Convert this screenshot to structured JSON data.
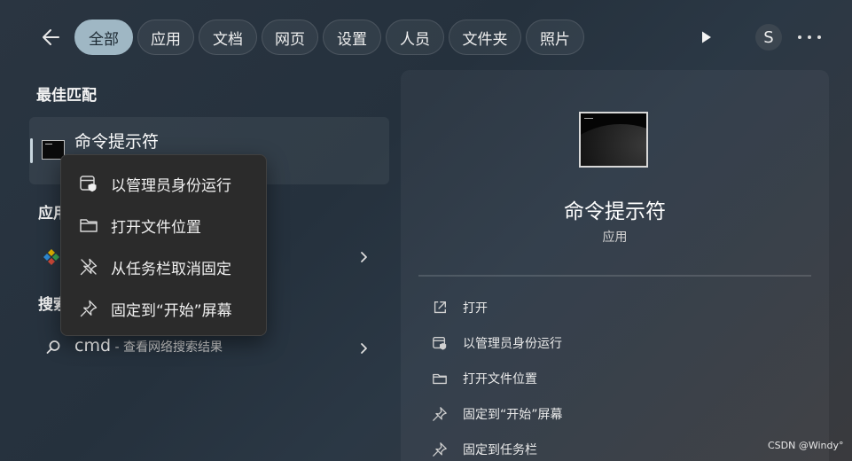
{
  "filters": {
    "items": [
      "全部",
      "应用",
      "文档",
      "网页",
      "设置",
      "人员",
      "文件夹",
      "照片"
    ],
    "active_index": 0
  },
  "avatar_initial": "S",
  "best_match": {
    "heading": "最佳匹配",
    "title": "命令提示符"
  },
  "apps_heading": "应用",
  "search_heading": "搜索",
  "web_search": {
    "query": "cmd",
    "suffix": " - 查看网络搜索结果"
  },
  "context_menu": {
    "items": [
      {
        "label": "以管理员身份运行",
        "icon": "admin-shield-icon"
      },
      {
        "label": "打开文件位置",
        "icon": "folder-icon"
      },
      {
        "label": "从任务栏取消固定",
        "icon": "unpin-icon"
      },
      {
        "label": "固定到“开始”屏幕",
        "icon": "pin-icon"
      }
    ]
  },
  "details": {
    "title": "命令提示符",
    "subtitle": "应用",
    "actions": [
      {
        "label": "打开",
        "icon": "open-external-icon"
      },
      {
        "label": "以管理员身份运行",
        "icon": "admin-shield-icon"
      },
      {
        "label": "打开文件位置",
        "icon": "folder-icon"
      },
      {
        "label": "固定到“开始”屏幕",
        "icon": "pin-icon"
      },
      {
        "label": "固定到任务栏",
        "icon": "pin-icon"
      }
    ]
  },
  "watermark": "CSDN @Windy°",
  "colors": {
    "active_pill": "#9fb7c4",
    "menu_bg": "#2b2b2b"
  }
}
